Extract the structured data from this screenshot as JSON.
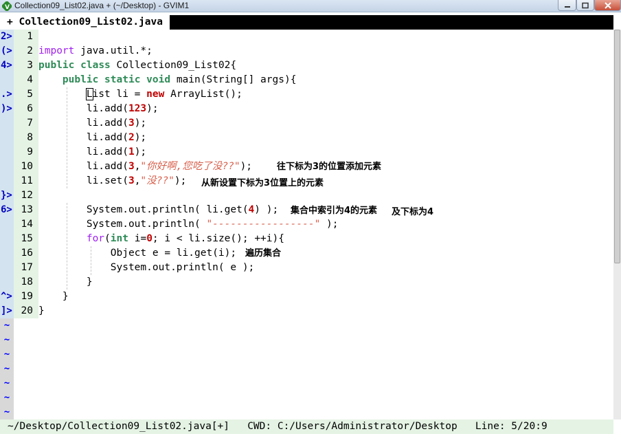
{
  "window": {
    "title": "Collection09_List02.java + (~/Desktop) - GVIM1"
  },
  "tabline": {
    "active_tab": "+ Collection09_List02.java"
  },
  "buffer": {
    "lines": [
      {
        "sign": "2>",
        "num": "1"
      },
      {
        "sign": "(>",
        "num": "2"
      },
      {
        "sign": "4>",
        "num": "3"
      },
      {
        "sign": "",
        "num": "4"
      },
      {
        "sign": ".>",
        "num": "5"
      },
      {
        "sign": ")>",
        "num": "6"
      },
      {
        "sign": "",
        "num": "7"
      },
      {
        "sign": "",
        "num": "8"
      },
      {
        "sign": "",
        "num": "9"
      },
      {
        "sign": "",
        "num": "10"
      },
      {
        "sign": "",
        "num": "11"
      },
      {
        "sign": "}>",
        "num": "12"
      },
      {
        "sign": "6>",
        "num": "13"
      },
      {
        "sign": "",
        "num": "14"
      },
      {
        "sign": "",
        "num": "15"
      },
      {
        "sign": "",
        "num": "16"
      },
      {
        "sign": "",
        "num": "17"
      },
      {
        "sign": "",
        "num": "18"
      },
      {
        "sign": "^>",
        "num": "19"
      },
      {
        "sign": "]>",
        "num": "20"
      }
    ],
    "code": {
      "l2": {
        "kw": "import",
        "rest": " java.util.*;"
      },
      "l3": {
        "kw1": "public",
        "kw2": "class",
        "rest": " Collection09_List02{"
      },
      "l4": {
        "kw1": "public",
        "kw2": "static",
        "kw3": "void",
        "rest": " main(String[] args){"
      },
      "l5": {
        "cursor": "L",
        "pre": "ist li = ",
        "kw": "new",
        "rest": " ArrayList();"
      },
      "l6": {
        "pre": "li.add(",
        "num": "123",
        "rest": ");"
      },
      "l7": {
        "pre": "li.add(",
        "num": "3",
        "rest": ");"
      },
      "l8": {
        "pre": "li.add(",
        "num": "2",
        "rest": ");"
      },
      "l9": {
        "pre": "li.add(",
        "num": "1",
        "rest": ");"
      },
      "l10": {
        "pre": "li.add(",
        "num": "3",
        "mid": ",",
        "str": "\"你好啊,您吃了没??\"",
        "rest": ");"
      },
      "l11": {
        "pre": "li.set(",
        "num": "3",
        "mid": ",",
        "str": "\"没??\"",
        "rest": ");"
      },
      "l13": {
        "pre": "System.out.println( li.get(",
        "num": "4",
        "rest": ") );"
      },
      "l14": {
        "pre": "System.out.println( ",
        "str": "\"-----------------\"",
        "rest": " );"
      },
      "l15": {
        "kw1": "for",
        "pre": "(",
        "kw2": "int",
        "mid": " i=",
        "num": "0",
        "rest": "; i < li.size(); ++i){"
      },
      "l16": {
        "text": "Object e = li.get(i);"
      },
      "l17": {
        "text": "System.out.println( e );"
      },
      "l18": {
        "text": "}"
      },
      "l19": {
        "text": "}"
      },
      "l20": {
        "text": "}"
      }
    },
    "tilde": "~"
  },
  "annotations": {
    "l10": "往下标为3的位置添加元素",
    "l11": "从新设置下标为3位置上的元素",
    "l13a": "集合中索引为4的元素",
    "l13b": "及下标为4",
    "l16": "遍历集合"
  },
  "statusline": {
    "text": "~/Desktop/Collection09_List02.java[+]   CWD: C:/Users/Administrator/Desktop   Line: 5/20:9"
  },
  "colors": {
    "keyword_purple": "#a020f0",
    "keyword_green": "#2e8b57",
    "number_red": "#c00000",
    "string_orange": "#d7604c",
    "sign_column": "#d3e3f0",
    "number_column": "#e4f3e4"
  }
}
